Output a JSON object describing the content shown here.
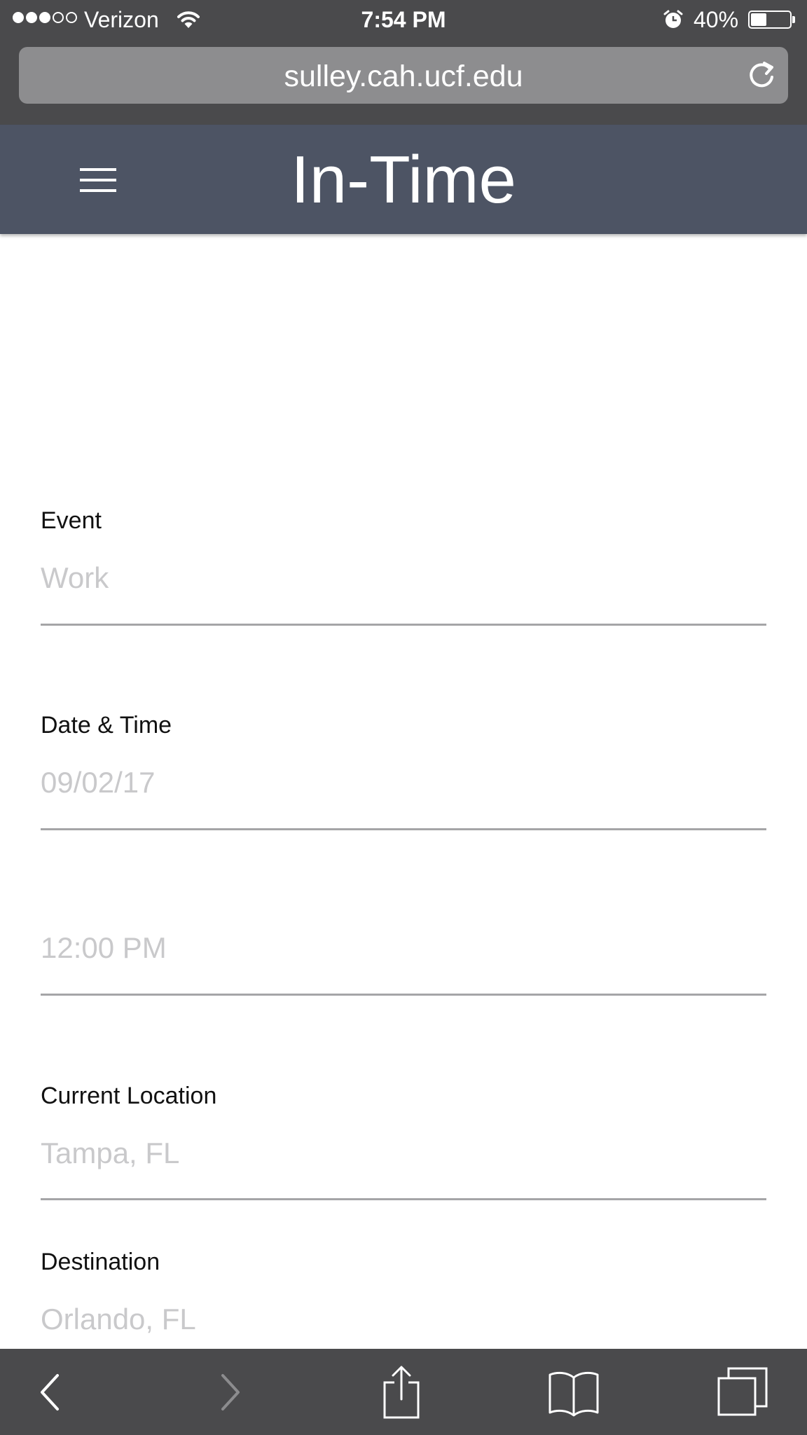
{
  "status_bar": {
    "carrier": "Verizon",
    "time": "7:54 PM",
    "battery_percent": "40%",
    "battery_level": 0.4,
    "signal_bars_filled": 3,
    "signal_bars_total": 5
  },
  "browser": {
    "url": "sulley.cah.ucf.edu",
    "icons": {
      "reload": "reload-icon",
      "back": "back-icon",
      "forward": "forward-icon",
      "share": "share-icon",
      "bookmarks": "bookmarks-icon",
      "tabs": "tabs-icon"
    }
  },
  "header": {
    "title": "In-Time",
    "menu_icon": "hamburger-menu-icon"
  },
  "form": {
    "event": {
      "label": "Event",
      "placeholder": "Work"
    },
    "datetime": {
      "label": "Date & Time",
      "date_placeholder": "09/02/17",
      "time_placeholder": "12:00 PM"
    },
    "current_location": {
      "label": "Current Location",
      "placeholder": "Tampa, FL"
    },
    "destination": {
      "label": "Destination",
      "placeholder": "Orlando, FL"
    }
  },
  "colors": {
    "chrome": "#4a4a4c",
    "header": "#4d5464",
    "placeholder": "#c9c9cb",
    "underline": "#a5a5a7"
  }
}
